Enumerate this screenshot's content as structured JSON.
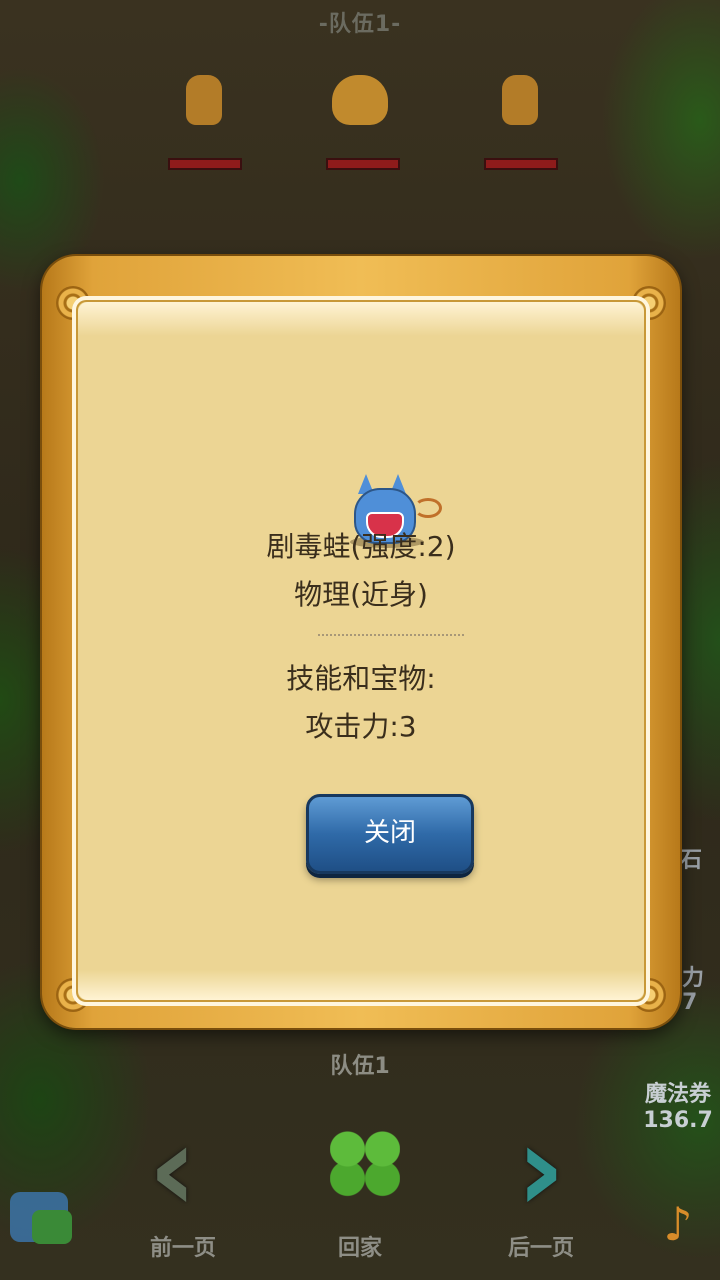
{
  "background": {
    "team_top_label": "-队伍1-",
    "side_labels": {
      "right_1": "石",
      "right_2": "力",
      "right_3": "7"
    },
    "bottom_team_label": "队伍1",
    "magic_ticket": {
      "label": "魔法券",
      "value": "136.7"
    },
    "nav": {
      "prev_label": "前一页",
      "home_label": "回家",
      "next_label": "后一页"
    },
    "icons": {
      "chat": "chat-icon",
      "sound": "sound-icon",
      "clover": "clover-icon",
      "prev": "chevron-left-icon",
      "next": "chevron-right-icon"
    }
  },
  "dialog": {
    "unit_name": "剧毒蛙(强度:2)",
    "unit_type": "物理(近身)",
    "skills_header": "技能和宝物:",
    "skill_1": "攻击力:3",
    "close_label": "关闭",
    "portrait_icon": "blue-cat-monster-icon"
  },
  "colors": {
    "dialog_frame": "#e0a33a",
    "dialog_paper": "#ecd594",
    "close_button": "#2f6aa8",
    "hp_bar": "#8f1b1b"
  }
}
